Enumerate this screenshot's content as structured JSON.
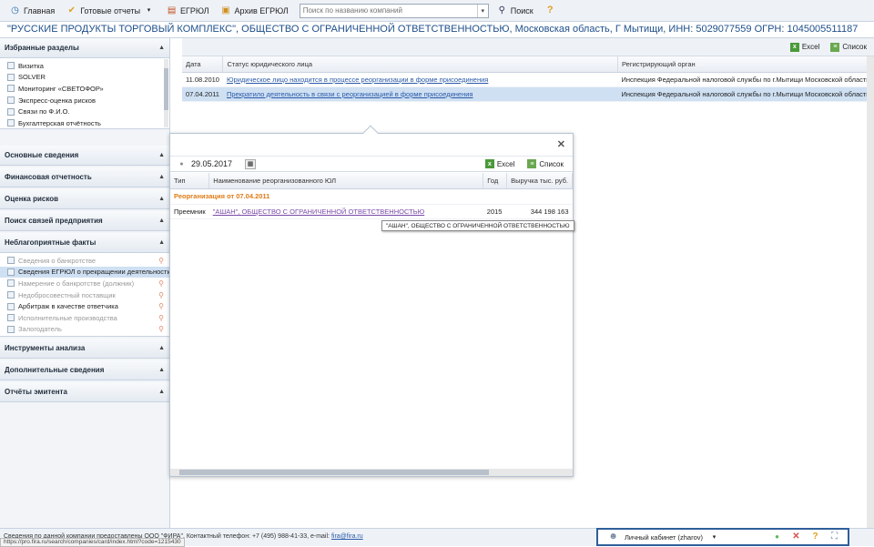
{
  "toolbar": {
    "home": "Главная",
    "reports": "Готовые отчеты",
    "egrul": "ЕГРЮЛ",
    "egrul_archive": "Архив ЕГРЮЛ",
    "search_placeholder": "Поиск по названию компаний",
    "search_button": "Поиск"
  },
  "company": {
    "title": "\"РУССКИЕ ПРОДУКТЫ ТОРГОВЫЙ КОМПЛЕКС\", ОБЩЕСТВО С ОГРАНИЧЕННОЙ ОТВЕТСТВЕННОСТЬЮ, Московская область, Г Мытищи, ИНН: 5029077559 ОГРН: 1045005511187"
  },
  "sidebar": {
    "favorites": {
      "title": "Избранные разделы",
      "items": [
        "Визитка",
        "SOLVER",
        "Мониторинг «СВЕТОФОР»",
        "Экспресс-оценка рисков",
        "Связи по Ф.И.О.",
        "Бухгалтерская отчётность"
      ]
    },
    "sections": [
      "Основные сведения",
      "Финансовая отчетность",
      "Оценка рисков",
      "Поиск связей предприятия"
    ],
    "unfavorable": {
      "title": "Неблагоприятные факты",
      "items": [
        "Сведения о банкротстве",
        "Сведения ЕГРЮЛ о прекращении деятельности",
        "Намерение о банкротстве (должник)",
        "Недобросовестный поставщик",
        "Арбитраж в качестве ответчика",
        "Исполнительные производства",
        "Залогодатель"
      ]
    },
    "bottom_sections": [
      "Инструменты анализа",
      "Дополнительные сведения",
      "Отчёты эмитента"
    ]
  },
  "main": {
    "excel": "Excel",
    "list": "Список",
    "columns": [
      "Дата",
      "Статус юридического лица",
      "Регистрирующий орган"
    ],
    "rows": [
      {
        "date": "11.08.2010",
        "status": "Юридическое лицо находится в процессе реорганизации в форме присоединения",
        "authority": "Инспекция Федеральной налоговой службы по г.Мытищи Московской области"
      },
      {
        "date": "07.04.2011",
        "status": "Прекратило деятельность в связи с реорганизацией в форме присоединения",
        "authority": "Инспекция Федеральной налоговой службы по г.Мытищи Московской области"
      }
    ]
  },
  "popup": {
    "date": "29.05.2017",
    "excel": "Excel",
    "list": "Список",
    "columns": [
      "Тип",
      "Наименование реорганизованного ЮЛ",
      "Год",
      "Выручка тыс. руб."
    ],
    "group": "Реорганизация от 07.04.2011",
    "row": {
      "type": "Преемник",
      "name": "\"АШАН\", ОБЩЕСТВО С ОГРАНИЧЕННОЙ ОТВЕТСТВЕННОСТЬЮ",
      "year": "2015",
      "revenue": "344 198 163"
    },
    "tooltip": "\"АШАН\", ОБЩЕСТВО С ОГРАНИЧЕННОЙ ОТВЕТСТВЕННОСТЬЮ"
  },
  "status": {
    "contacts_prefix": "Сведения по данной компании предоставлены ООО \"ФИРА\". Контактный телефон: +7 (495) 988-41-33, e-mail: ",
    "email": "fira@fira.ru",
    "url": "https://pro.fira.ru/search/companies/card/index.html?code=1215430"
  },
  "cabinet": {
    "label": "Личный кабинет (zharov)"
  }
}
